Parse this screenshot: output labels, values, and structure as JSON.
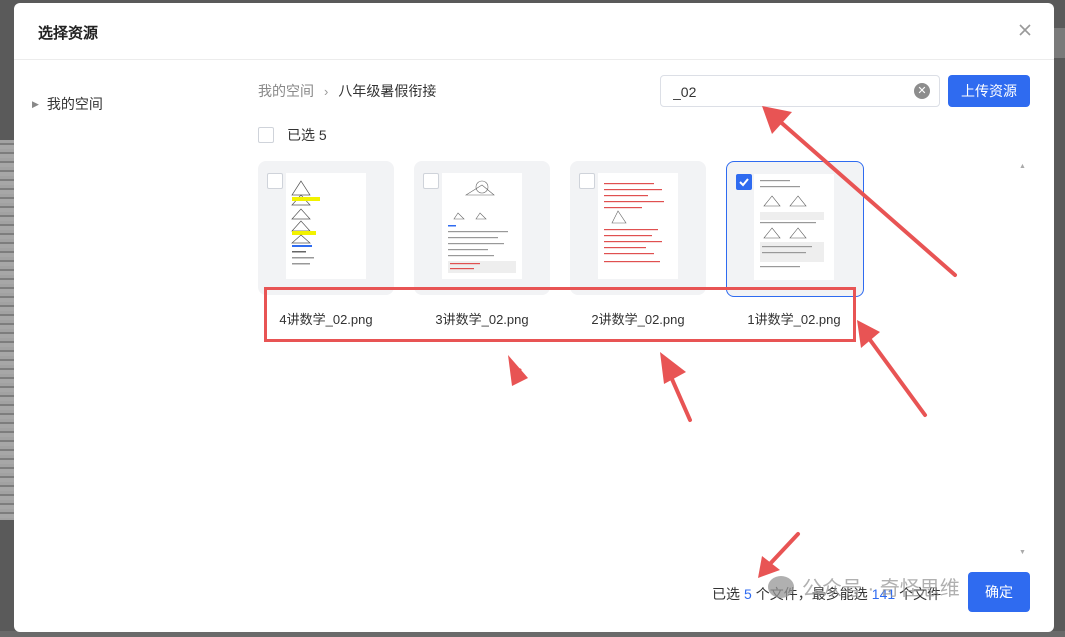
{
  "dialog": {
    "title": "选择资源"
  },
  "sidebar": {
    "items": [
      {
        "label": "我的空间"
      }
    ]
  },
  "breadcrumb": {
    "root": "我的空间",
    "separator": "›",
    "current": "八年级暑假衔接"
  },
  "search": {
    "value": "_02",
    "clear_icon": "clear-circle-icon"
  },
  "toolbar": {
    "upload_label": "上传资源"
  },
  "selection": {
    "select_all_label": "已选 5"
  },
  "files": [
    {
      "name": "4讲数学_02.png",
      "checked": false,
      "thumb_icon": "worksheet-thumbnail"
    },
    {
      "name": "3讲数学_02.png",
      "checked": false,
      "thumb_icon": "worksheet-thumbnail"
    },
    {
      "name": "2讲数学_02.png",
      "checked": false,
      "thumb_icon": "worksheet-thumbnail"
    },
    {
      "name": "1讲数学_02.png",
      "checked": true,
      "thumb_icon": "worksheet-thumbnail"
    }
  ],
  "footer": {
    "selected_prefix": "已选",
    "selected_count": "5",
    "selected_suffix": "个文件，最多能选",
    "max_count": "141",
    "max_suffix": "个文件",
    "confirm_label": "确定"
  },
  "watermark": {
    "text": "公众号 · 奇怪思维"
  },
  "colors": {
    "accent": "#2f6bf0",
    "annotation": "#e85454"
  }
}
